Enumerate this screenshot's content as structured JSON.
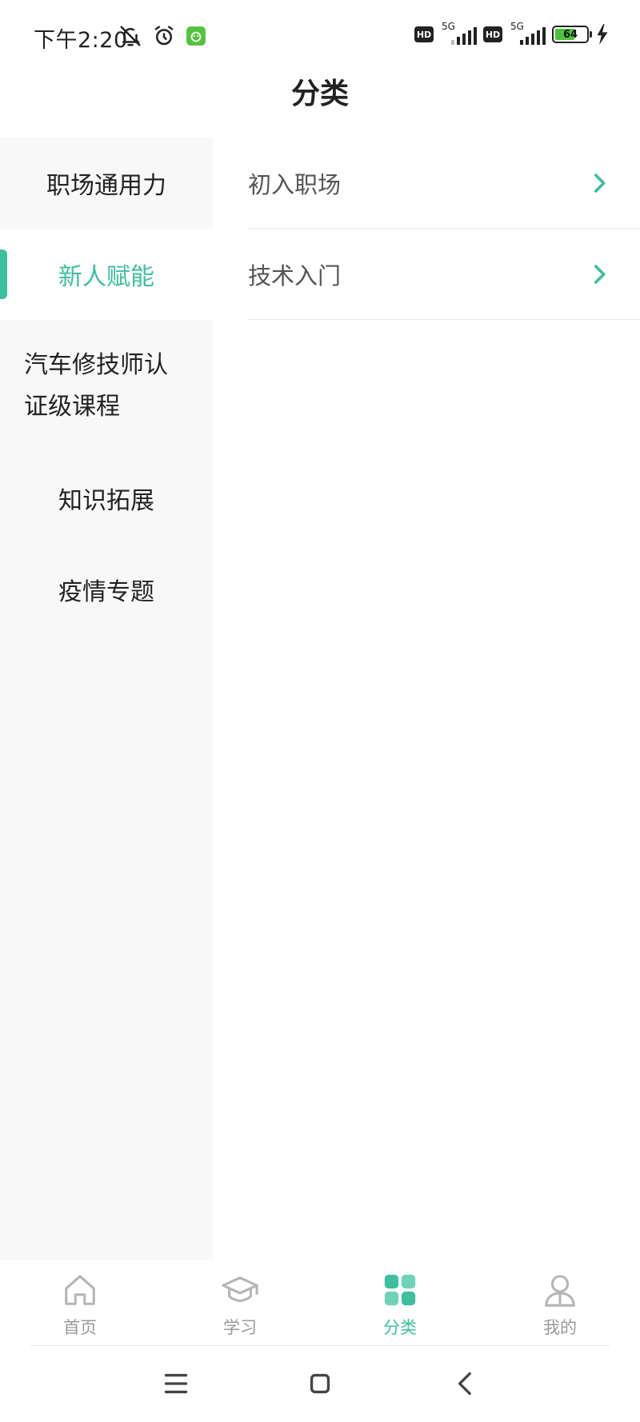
{
  "status_bar": {
    "time": "下午2:20",
    "network_tag_1": "5G",
    "network_tag_2": "5G",
    "hd_label": "HD",
    "battery_level": "64",
    "battery_fraction": 0.64,
    "icons": [
      "bell-off-icon",
      "alarm-icon",
      "app-notification-icon",
      "hd-icon",
      "signal-icon",
      "hd-icon",
      "signal-icon",
      "battery-icon",
      "charging-icon"
    ]
  },
  "header": {
    "title": "分类"
  },
  "sidebar": {
    "items": [
      {
        "label": "职场通用力",
        "active": false
      },
      {
        "label": "新人赋能",
        "active": true
      },
      {
        "label": "汽车修技师认证级课程",
        "active": false
      },
      {
        "label": "知识拓展",
        "active": false
      },
      {
        "label": "疫情专题",
        "active": false
      }
    ]
  },
  "subcategories": [
    {
      "label": "初入职场",
      "icon": "chevron-right-icon"
    },
    {
      "label": "技术入门",
      "icon": "chevron-right-icon"
    }
  ],
  "tab_bar": {
    "tabs": [
      {
        "label": "首页",
        "icon": "home-icon",
        "active": false
      },
      {
        "label": "学习",
        "icon": "graduation-cap-icon",
        "active": false
      },
      {
        "label": "分类",
        "icon": "category-grid-icon",
        "active": true
      },
      {
        "label": "我的",
        "icon": "user-icon",
        "active": false
      }
    ]
  },
  "nav_bar": {
    "icons": [
      "menu-icon",
      "home-square-icon",
      "back-icon"
    ]
  },
  "colors": {
    "accent": "#3dbfa0",
    "sidebar_bg": "#f8f8f8",
    "inactive_tab": "#9a9a9a",
    "battery_fill": "#4cc23a"
  }
}
